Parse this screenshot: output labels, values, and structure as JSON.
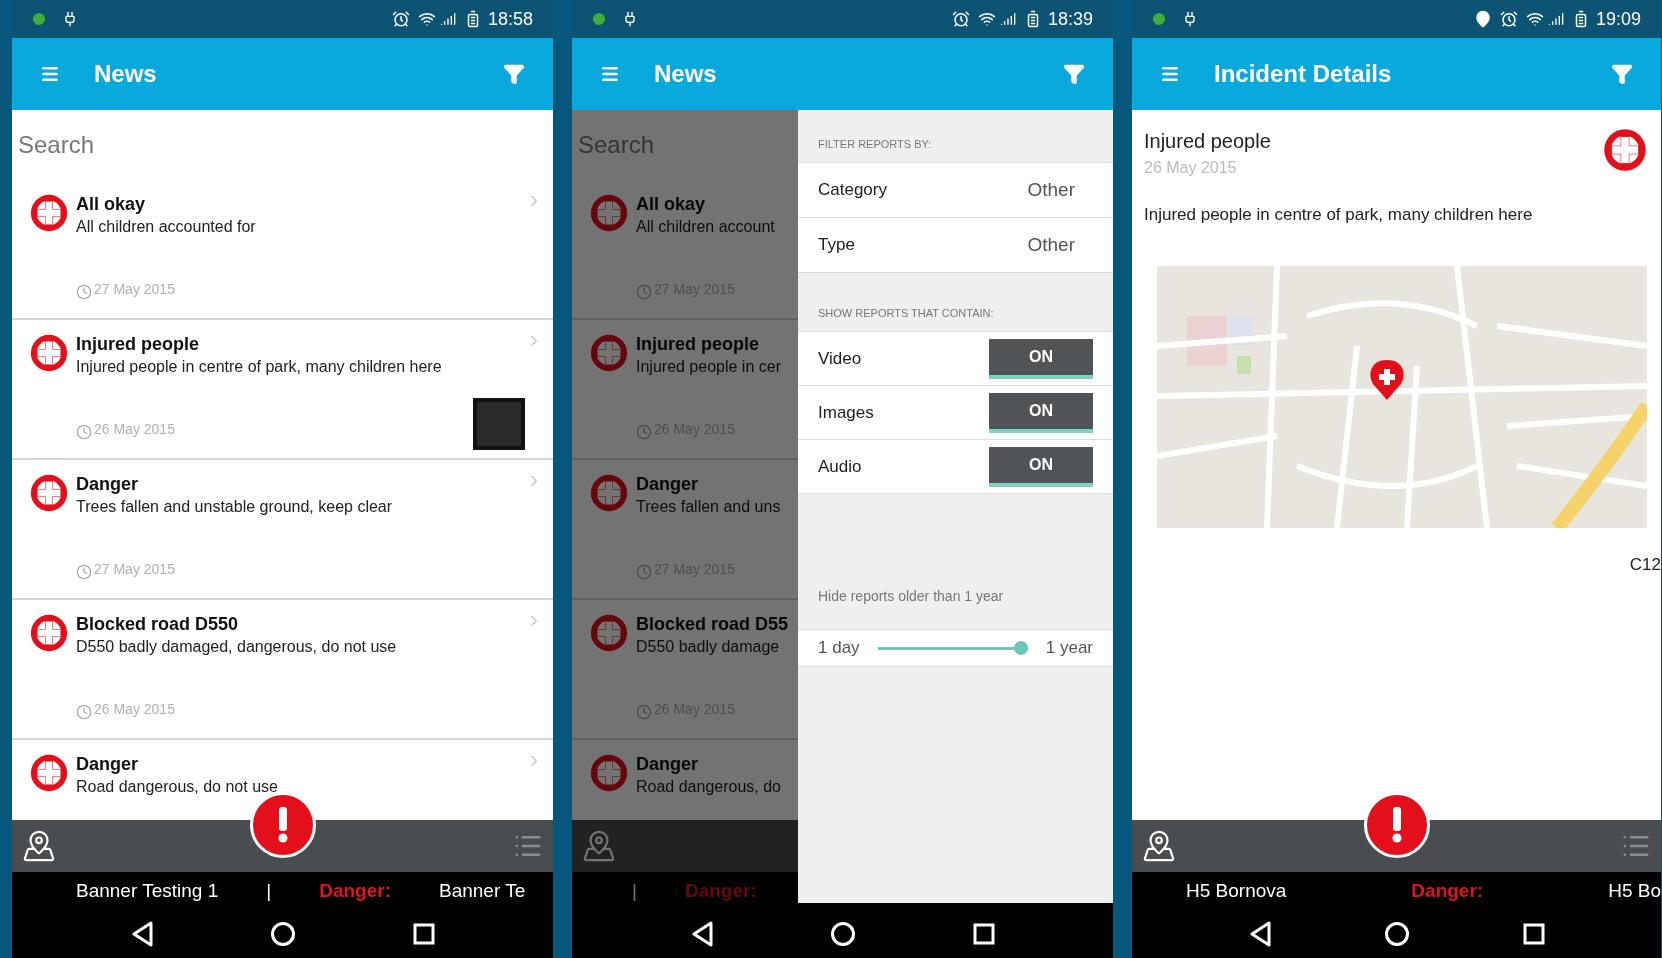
{
  "screens": [
    {
      "kind": "list",
      "status": {
        "time": "18:58",
        "location": false
      },
      "app_bar": {
        "title": "News"
      },
      "search": {
        "placeholder": "Search"
      },
      "items": [
        {
          "title": "All okay",
          "subtitle": "All children accounted for",
          "date": "27 May 2015",
          "photo": false
        },
        {
          "title": "Injured people",
          "subtitle": "Injured people in centre of park, many children here",
          "date": "26 May 2015",
          "photo": true
        },
        {
          "title": "Danger",
          "subtitle": "Trees fallen and unstable ground, keep clear",
          "date": "27 May 2015",
          "photo": false
        },
        {
          "title": "Blocked road D550",
          "subtitle": "D550 badly damaged, dangerous, do not use",
          "date": "26 May 2015",
          "photo": false
        },
        {
          "title": "Danger",
          "subtitle": "Road dangerous, do not use"
        }
      ],
      "bottom_bar": {
        "fab": true,
        "list_icon": true
      },
      "banner": [
        {
          "text": "Banner Testing 1",
          "kind": "text"
        },
        {
          "text": "|",
          "kind": "text"
        },
        {
          "text": "Danger:",
          "kind": "danger"
        },
        {
          "text": "Banner Te",
          "kind": "text"
        }
      ],
      "dimmed": false
    },
    {
      "kind": "list",
      "status": {
        "time": "18:39",
        "location": false
      },
      "app_bar": {
        "title": "News"
      },
      "search": {
        "placeholder": "Search"
      },
      "items": [
        {
          "title": "All okay",
          "subtitle": "All children account",
          "date": "27 May 2015"
        },
        {
          "title": "Injured people",
          "subtitle": "Injured people in cer",
          "date": "26 May 2015"
        },
        {
          "title": "Danger",
          "subtitle": "Trees fallen and uns",
          "date": "27 May 2015"
        },
        {
          "title": "Blocked road D55",
          "subtitle": "D550 badly damage",
          "date": "26 May 2015"
        },
        {
          "title": "Danger",
          "subtitle": "Road dangerous, do"
        }
      ],
      "banner": [
        {
          "text": "|",
          "kind": "text"
        },
        {
          "text": "Danger:",
          "kind": "danger"
        }
      ],
      "dimmed": true,
      "filter_panel": {
        "rows": [
          {
            "kind": "header",
            "text": "FILTER REPORTS BY:"
          },
          {
            "kind": "select",
            "label": "Category",
            "value": "Other"
          },
          {
            "kind": "select",
            "label": "Type",
            "value": "Other"
          },
          {
            "kind": "header",
            "text": "SHOW REPORTS THAT CONTAIN:"
          },
          {
            "kind": "toggle",
            "label": "Video",
            "on": true,
            "state_text": "ON"
          },
          {
            "kind": "toggle",
            "label": "Images",
            "on": true,
            "state_text": "ON"
          },
          {
            "kind": "toggle",
            "label": "Audio",
            "on": true,
            "state_text": "ON"
          },
          {
            "kind": "caption",
            "text": "Hide reports older than 1 year"
          },
          {
            "kind": "slider",
            "min_label": "1 day",
            "max_label": "1 year",
            "level": 1
          }
        ]
      }
    },
    {
      "kind": "detail",
      "status": {
        "time": "19:09",
        "location": true
      },
      "app_bar": {
        "title": "Incident Details"
      },
      "detail": {
        "title": "Injured people",
        "date": "26 May 2015",
        "description": "Injured people in centre of park, many children here",
        "code": "C12"
      },
      "bottom_bar": {
        "fab": true,
        "list_icon": true
      },
      "banner": [
        {
          "text": "H5 Bornova",
          "kind": "text"
        },
        {
          "text": "Danger:",
          "kind": "danger"
        },
        {
          "text": "H5 Bo",
          "kind": "text"
        }
      ],
      "dimmed": false
    }
  ]
}
